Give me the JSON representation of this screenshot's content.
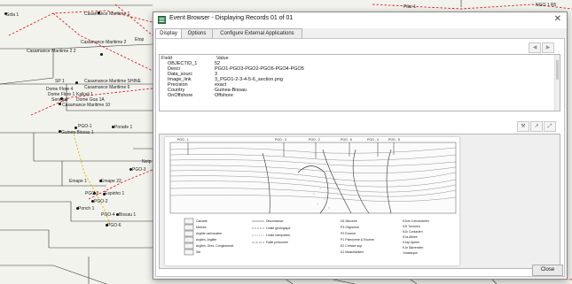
{
  "map": {
    "labels": {
      "top_left": "Sola 1",
      "top_c1": "Casamance Maritime 1",
      "m2": "Casamance Maritime 2",
      "m2_m2": "Casamance Maritime 2 2",
      "etop": "Etop",
      "sp": "SP 1",
      "shine": "Casamance Maritime SHINE",
      "m6": "Casamance Maritime 6",
      "doni": "Dome Flore 4",
      "doni2": "Dome Flore 1",
      "kalkali": "Kalkali 1",
      "senegal": "Senegal",
      "gea": "Dome Goa 1A",
      "m10": "Casamance Maritime 10",
      "pgo1": "PGO-1",
      "bissau": "Guinea Bissau 1",
      "porade": "Porade 1",
      "pgo3": "PGO-3",
      "emape": "Emape 1",
      "emape22": "Emape 22",
      "pgo5": "PGO-5",
      "espinho": "Espinho 1",
      "pgo2": "PGO-2",
      "ponch": "Ponch 1",
      "pgo4": "PGO-4",
      "bissau2": "Bissau 1",
      "pgo6": "PGO-6",
      "tr_pillar": "Pilar 1",
      "tr_ngo": "NGO 1 R5",
      "left_cut": "Netp"
    }
  },
  "dialog": {
    "title": "Event Browser - Displaying Records 01 of 01",
    "close_glyph": "✕",
    "tabs": [
      "Display",
      "Options",
      "Configure External Applications"
    ],
    "nav": {
      "prev": "◀",
      "next": "▶"
    },
    "grid": {
      "headers": {
        "field": "Field",
        "value": "Value"
      },
      "rows": [
        {
          "field": "OBJECTID_1",
          "value": "52"
        },
        {
          "field": "Descr",
          "value": "PGO1-PGO3-PGO2-PGO6-PGO4-PGO5"
        },
        {
          "field": "Data_sourc",
          "value": "3"
        },
        {
          "field": "Image_link",
          "value": "3_PGO1-2-3-4-5-6_section.png"
        },
        {
          "field": "Precision",
          "value": "exact"
        },
        {
          "field": "Country",
          "value": "Guinea-Bissau"
        },
        {
          "field": "OnOffshore",
          "value": "Offshore"
        }
      ]
    },
    "tools": {
      "wrench": "⚒",
      "link": "↗",
      "fit": "⤢"
    },
    "close_button": "Close",
    "section": {
      "wells": [
        "PGO - 1",
        "PGO - 3",
        "PGO - 2",
        "PGO - 6",
        "PGO - 4",
        "PGO - 5"
      ],
      "legend_left": [
        "Calcaire",
        "Marnes",
        "Argilite carbonatee",
        "Argiles, Argilite",
        "Argiles, Gres, Conglomerat",
        "Sel"
      ],
      "legend_mid": [
        "Discordance",
        "Limite geologique",
        "Limite interpretee",
        "Faille presumee"
      ],
      "legend_right": [
        "N1 Miocene",
        "P3 Oligocene",
        "P2 Eocene",
        "P1 Paleocene & Eocene",
        "K2 Cretace sup.",
        "K1 Maastrichtien"
      ],
      "legend_far": [
        "K2cm Cenomanien",
        "K2t Turonien",
        "K2c Coniacien",
        "K1a Albien",
        "K1ap Aptien",
        "K1n Barremien",
        "Jurassique"
      ]
    }
  }
}
